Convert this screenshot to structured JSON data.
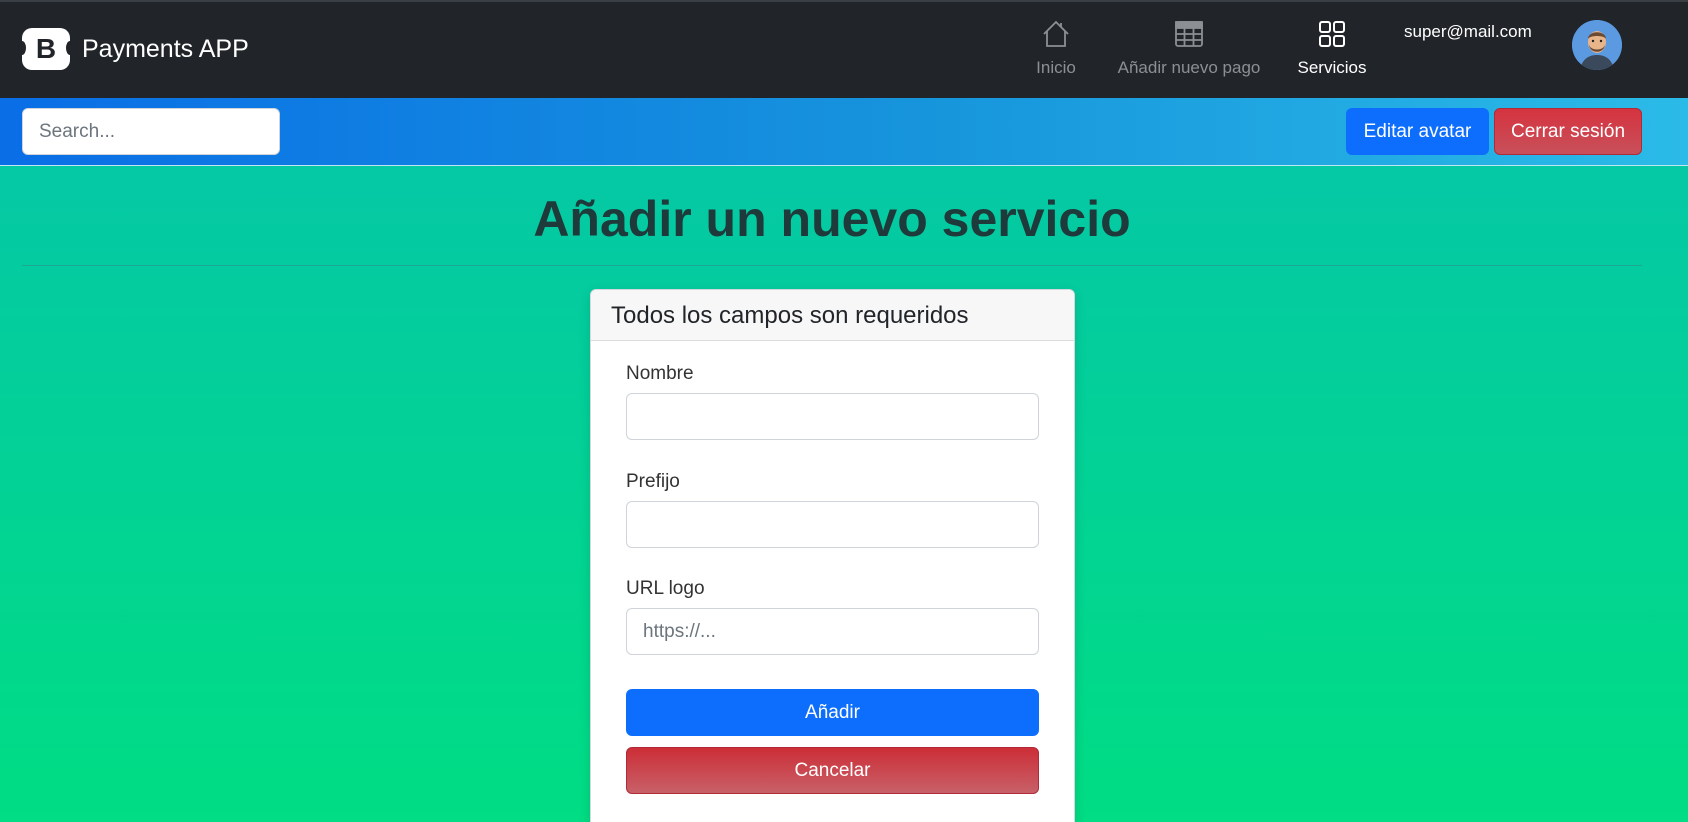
{
  "header": {
    "brand_letter": "B",
    "brand_name": "Payments APP",
    "nav": [
      {
        "label": "Inicio",
        "icon": "house-icon"
      },
      {
        "label": "Añadir nuevo pago",
        "icon": "table-icon"
      },
      {
        "label": "Servicios",
        "icon": "grid-icon",
        "active": true
      }
    ],
    "user_email": "super@mail.com"
  },
  "toolbar": {
    "search_placeholder": "Search...",
    "edit_avatar_label": "Editar avatar",
    "logout_label": "Cerrar sesión"
  },
  "main": {
    "title": "Añadir un nuevo servicio",
    "card_header": "Todos los campos son requeridos",
    "fields": [
      {
        "label": "Nombre",
        "value": "",
        "placeholder": ""
      },
      {
        "label": "Prefijo",
        "value": "",
        "placeholder": ""
      },
      {
        "label": "URL logo",
        "value": "",
        "placeholder": "https://..."
      }
    ],
    "submit_label": "Añadir",
    "cancel_label": "Cancelar"
  },
  "colors": {
    "topbar": "#212529",
    "primary": "#0d6efd",
    "danger": "#dc3545",
    "background_top": "#05c8a5",
    "background_bottom": "#00dd84"
  }
}
